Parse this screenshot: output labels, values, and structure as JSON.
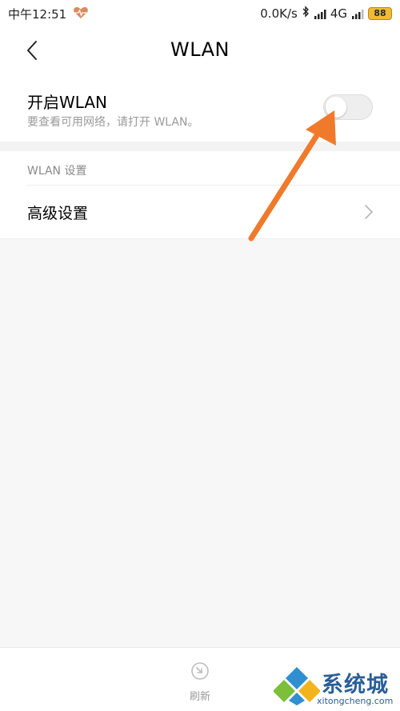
{
  "status_bar": {
    "time": "中午12:51",
    "network_speed": "0.0K/s",
    "network_type": "4G",
    "battery": "88"
  },
  "header": {
    "title": "WLAN"
  },
  "wlan_toggle": {
    "label": "开启WLAN",
    "hint": "要查看可用网络，请打开 WLAN。",
    "state": "off"
  },
  "wlan_settings": {
    "section_label": "WLAN 设置",
    "advanced_label": "高级设置"
  },
  "bottom_bar": {
    "refresh_label": "刷新"
  },
  "watermark": {
    "text": "系统城",
    "url": "xitongcheng.com"
  },
  "colors": {
    "annotation_arrow": "#f07a2c",
    "status_heart": "#d98b5f",
    "battery": "#f2bb2f",
    "watermark_blue": "#2a5e96"
  }
}
